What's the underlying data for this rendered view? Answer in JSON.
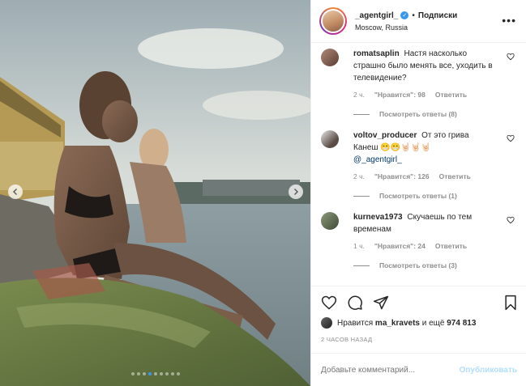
{
  "header": {
    "username": "_agentgirl_",
    "bullet": "•",
    "follow_label": "Подписки",
    "location": "Moscow, Russia"
  },
  "carousel": {
    "total": 9,
    "active_index": 3
  },
  "comments": [
    {
      "user": "romatsaplin",
      "text": "Настя насколько страшно было менять все, уходить в телевидение?",
      "time": "2 ч.",
      "likes": "\"Нравится\": 98",
      "reply_label": "Ответить",
      "view_replies": "Посмотреть ответы (8)"
    },
    {
      "user": "voltov_producer",
      "text": "От это грива Канеш 😁😁🤘🏻🤘🏻🤘🏻",
      "mention": "@_agentgirl_",
      "time": "2 ч.",
      "likes": "\"Нравится\": 126",
      "reply_label": "Ответить",
      "view_replies": "Посмотреть ответы (1)"
    },
    {
      "user": "kurneva1973",
      "text": "Скучаешь по тем временам",
      "time": "1 ч.",
      "likes": "\"Нравится\": 24",
      "reply_label": "Ответить",
      "view_replies": "Посмотреть ответы (3)"
    }
  ],
  "likes": {
    "prefix": "Нравится",
    "user": "ma_kravets",
    "middle": "и ещё",
    "count": "974 813"
  },
  "timestamp": "2 ЧАСОВ НАЗАД",
  "comment_box": {
    "placeholder": "Добавьте комментарий...",
    "post_label": "Опубликовать"
  },
  "colors": {
    "accent": "#3897f0",
    "post_disabled": "#b2dffc",
    "muted": "#8e8e8e"
  }
}
